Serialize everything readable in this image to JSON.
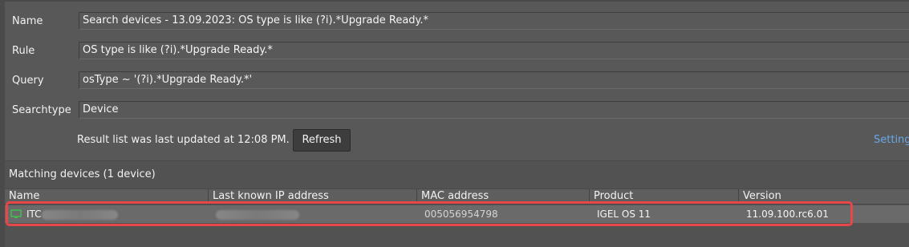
{
  "form": {
    "name_label": "Name",
    "name_value": "Search devices - 13.09.2023: OS type is like (?i).*Upgrade Ready.*",
    "rule_label": "Rule",
    "rule_value": "OS type is like (?i).*Upgrade Ready.*",
    "query_label": "Query",
    "query_value": "osType ~ '(?i).*Upgrade Ready.*'",
    "searchtype_label": "Searchtype",
    "searchtype_value": "Device"
  },
  "status": {
    "text": "Result list was last updated at 12:08 PM.",
    "refresh_label": "Refresh",
    "settings_label": "Settings"
  },
  "results": {
    "title": "Matching devices (1 device)",
    "columns": [
      "Name",
      "Last known IP address",
      "MAC address",
      "Product",
      "Version"
    ],
    "rows": [
      {
        "name": "ITC",
        "ip": "",
        "mac": "005056954798",
        "product": "IGEL OS 11",
        "version": "11.09.100.rc6.01",
        "icon": "monitor-icon"
      }
    ]
  },
  "colors": {
    "highlight": "#e8474a",
    "link": "#68a8e6",
    "device_icon": "#3fbf4f"
  }
}
